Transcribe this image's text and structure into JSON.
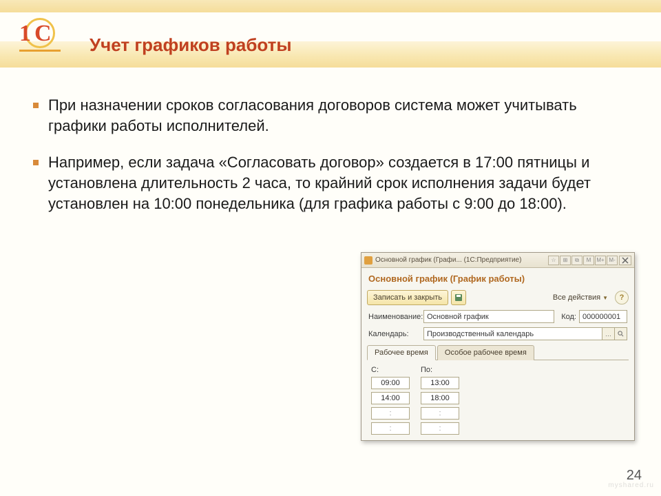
{
  "slide": {
    "title": "Учет графиков работы",
    "bullets": [
      "При назначении сроков согласования договоров система может учитывать графики работы исполнителей.",
      "Например, если задача «Согласовать договор» создается в 17:00 пятницы и установлена длительность 2 часа, то крайний срок исполнения задачи будет установлен на 10:00 понедельника (для графика работы с 9:00 до 18:00)."
    ],
    "page_number": "24",
    "watermark": "myshared.ru"
  },
  "dialog": {
    "titlebar": "Основной график (Графи...   (1С:Предприятие)",
    "tb_buttons": [
      "☆",
      "⊞",
      "⧉",
      "M",
      "M+",
      "M-"
    ],
    "form_title": "Основной график (График работы)",
    "toolbar": {
      "save_close": "Записать и закрыть",
      "all_actions": "Все действия"
    },
    "fields": {
      "name_label": "Наименование:",
      "name_value": "Основной график",
      "code_label": "Код:",
      "code_value": "000000001",
      "calendar_label": "Календарь:",
      "calendar_value": "Производственный календарь"
    },
    "tabs": {
      "t1": "Рабочее время",
      "t2": "Особое рабочее время"
    },
    "time": {
      "col_from": "С:",
      "col_to": "По:",
      "rows": [
        {
          "from": "09:00",
          "to": "13:00"
        },
        {
          "from": "14:00",
          "to": "18:00"
        },
        {
          "from": ":",
          "to": ":"
        },
        {
          "from": ":",
          "to": ":"
        }
      ]
    }
  }
}
